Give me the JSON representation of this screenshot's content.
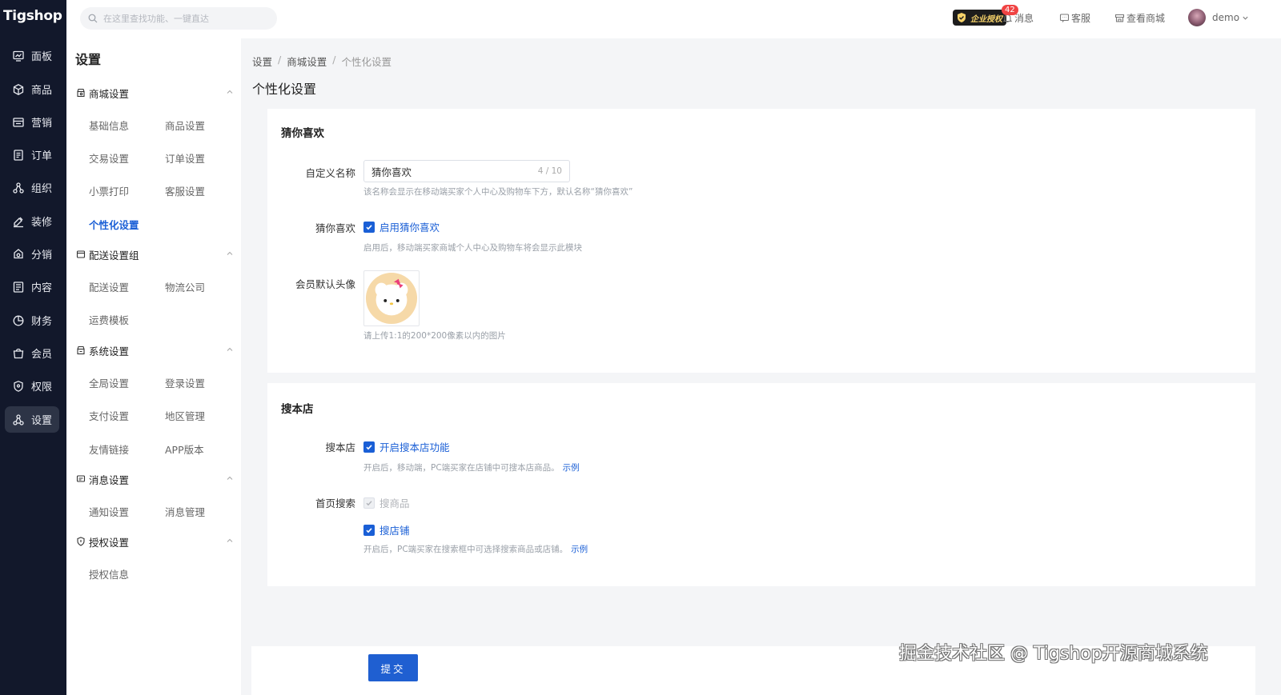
{
  "app": {
    "logo": "Tigshop"
  },
  "search": {
    "placeholder": "在这里查找功能、一键直达"
  },
  "topbar": {
    "license_badge": "企业授权",
    "messages_count": "42",
    "messages": "消息",
    "service": "客服",
    "view_store": "查看商城",
    "user": "demo"
  },
  "leftnav": {
    "items": [
      {
        "label": "面板",
        "icon": "dashboard-icon"
      },
      {
        "label": "商品",
        "icon": "box-icon"
      },
      {
        "label": "营销",
        "icon": "marketing-icon"
      },
      {
        "label": "订单",
        "icon": "order-icon"
      },
      {
        "label": "组织",
        "icon": "organization-icon"
      },
      {
        "label": "装修",
        "icon": "decoration-icon"
      },
      {
        "label": "分销",
        "icon": "distribution-icon"
      },
      {
        "label": "内容",
        "icon": "content-icon"
      },
      {
        "label": "财务",
        "icon": "finance-icon"
      },
      {
        "label": "会员",
        "icon": "member-icon"
      },
      {
        "label": "权限",
        "icon": "permission-icon"
      },
      {
        "label": "设置",
        "icon": "settings-icon"
      }
    ]
  },
  "subnav": {
    "title": "设置",
    "groups": [
      {
        "label": "商城设置",
        "items": [
          "基础信息",
          "商品设置",
          "交易设置",
          "订单设置",
          "小票打印",
          "客服设置",
          "个性化设置"
        ]
      },
      {
        "label": "配送设置组",
        "items": [
          "配送设置",
          "物流公司",
          "运费模板"
        ]
      },
      {
        "label": "系统设置",
        "items": [
          "全局设置",
          "登录设置",
          "支付设置",
          "地区管理",
          "友情链接",
          "APP版本"
        ]
      },
      {
        "label": "消息设置",
        "items": [
          "通知设置",
          "消息管理"
        ]
      },
      {
        "label": "授权设置",
        "items": [
          "授权信息"
        ]
      }
    ]
  },
  "breadcrumb": [
    "设置",
    "商城设置",
    "个性化设置"
  ],
  "page_title": "个性化设置",
  "card1": {
    "title": "猜你喜欢",
    "custom_name_label": "自定义名称",
    "custom_name_value": "猜你喜欢",
    "custom_name_count": "4 / 10",
    "custom_name_hint": "该名称会显示在移动端买家个人中心及购物车下方，默认名称“猜你喜欢”",
    "guess_label": "猜你喜欢",
    "guess_checkbox": "启用猜你喜欢",
    "guess_hint": "启用后，移动端买家商城个人中心及购物车将会显示此模块",
    "avatar_label": "会员默认头像",
    "avatar_hint": "请上传1:1的200*200像素以内的图片"
  },
  "card2": {
    "title": "搜本店",
    "search_store_label": "搜本店",
    "search_store_checkbox": "开启搜本店功能",
    "search_store_hint": "开启后，移动端，PC端买家在店铺中可搜本店商品。",
    "search_store_example": "示例",
    "home_search_label": "首页搜索",
    "home_search_goods": "搜商品",
    "home_search_shops": "搜店铺",
    "home_search_hint": "开启后，PC端买家在搜索框中可选择搜索商品或店铺。",
    "home_search_example": "示例"
  },
  "submit_label": "提交",
  "watermark": "掘金技术社区 @ Tigshop开源商城系统",
  "colors": {
    "accent": "#1a5fd6",
    "nav_bg": "#12182b",
    "badge": "#f04343"
  }
}
